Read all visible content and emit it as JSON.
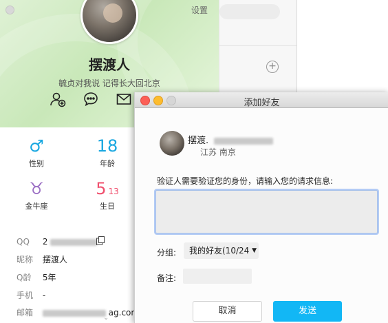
{
  "profile": {
    "settings_label": "设置",
    "name": "摆渡人",
    "signature": "毓贞对我说 记得长大回北京",
    "icons": [
      "add-friend-icon",
      "chat-icon",
      "mail-icon"
    ],
    "stats": [
      {
        "icon": "♂",
        "label": "性别",
        "color": "#18a7e0"
      },
      {
        "icon": "18",
        "label": "年龄",
        "color": "#18a7e0"
      },
      {
        "icon": "♉",
        "label": "金牛座",
        "color": "#9b6fc4"
      },
      {
        "icon": "5",
        "sub": "13",
        "label": "生日",
        "color": "#f0506e"
      }
    ],
    "info": [
      {
        "key": "QQ",
        "value": "2"
      },
      {
        "key": "昵称",
        "value": "摆渡人"
      },
      {
        "key": "Q龄",
        "value": "5年"
      },
      {
        "key": "手机",
        "value": "-"
      },
      {
        "key": "邮箱",
        "value": "ag.com"
      }
    ]
  },
  "dialog": {
    "title": "添加好友",
    "friend_name": "摆渡.",
    "friend_location": "江苏 南京",
    "prompt": "验证人需要验证您的身份，请输入您的请求信息:",
    "request_value": "",
    "group_label": "分组:",
    "group_value": "我的好友(10/24",
    "note_label": "备注:",
    "note_value": "",
    "cancel_label": "取消",
    "send_label": "发送"
  },
  "colors": {
    "accent": "#12b7f5",
    "header_green": "#c9e8b9"
  }
}
